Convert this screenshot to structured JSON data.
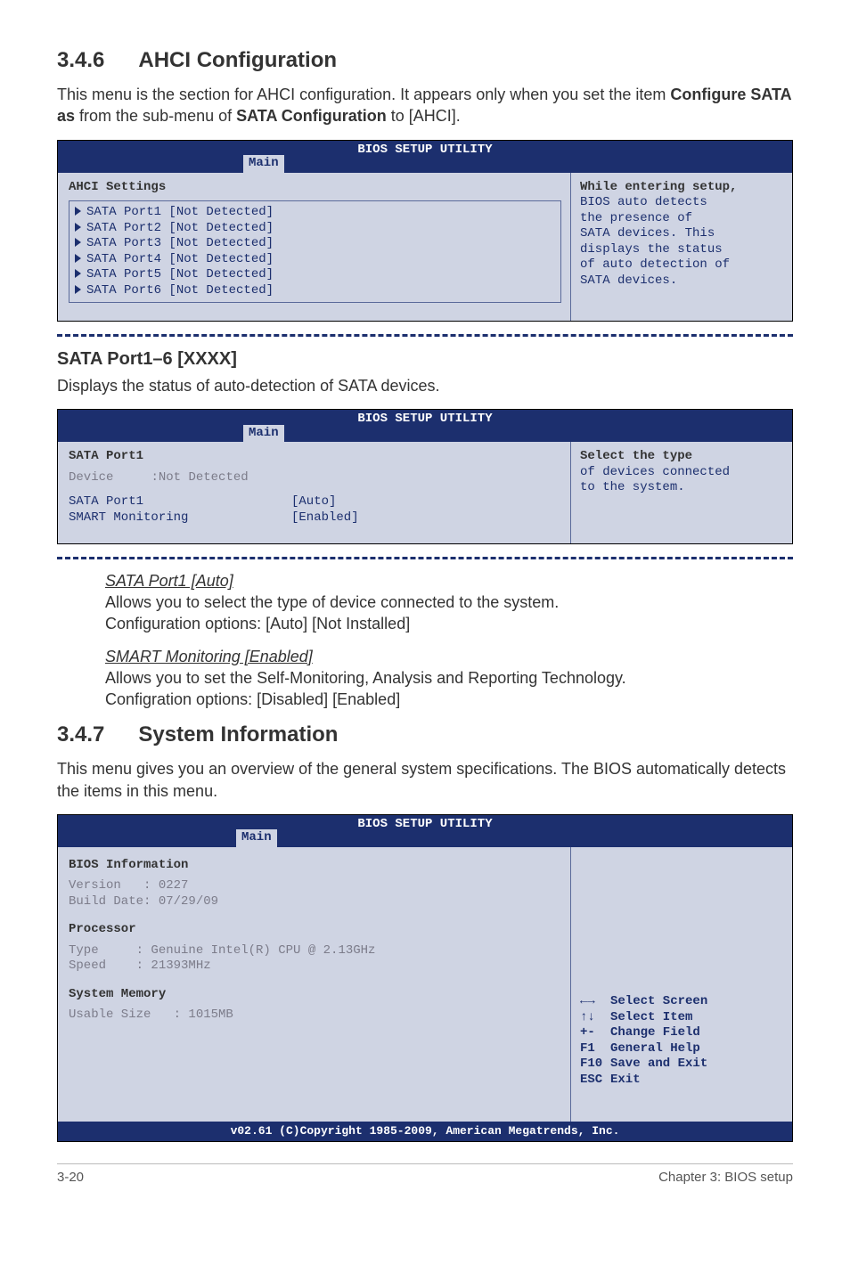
{
  "sec346": {
    "num": "3.4.6",
    "title": "AHCI Configuration",
    "intro_part1": "This menu is the section for AHCI configuration. It appears only when you set the item ",
    "intro_bold1": "Configure SATA as",
    "intro_part2": " from the sub-menu of ",
    "intro_bold2": "SATA Configuration",
    "intro_part3": " to [AHCI]."
  },
  "bios1": {
    "title": "BIOS SETUP UTILITY",
    "tab": "Main",
    "heading": "AHCI Settings",
    "items": [
      "SATA Port1 [Not Detected]",
      "SATA Port2 [Not Detected]",
      "SATA Port3 [Not Detected]",
      "SATA Port4 [Not Detected]",
      "SATA Port5 [Not Detected]",
      "SATA Port6 [Not Detected]"
    ],
    "help_first": "While entering setup,",
    "help_rest": "BIOS auto detects\nthe presence of\nSATA devices. This\ndisplays the status\nof auto detection of\nSATA devices."
  },
  "sataport": {
    "heading": "SATA Port1–6 [XXXX]",
    "desc": "Displays the status of auto-detection of SATA devices."
  },
  "bios2": {
    "title": "BIOS SETUP UTILITY",
    "tab": "Main",
    "heading": "SATA Port1",
    "dev_label": "Device",
    "dev_value": ":Not Detected",
    "row1_l": "SATA Port1",
    "row1_r": "[Auto]",
    "row2_l": "SMART Monitoring",
    "row2_r": "[Enabled]",
    "help_first": "Select the type",
    "help_rest": "of devices connected\nto the system."
  },
  "opts": {
    "o1_head": "SATA Port1 [Auto]",
    "o1_l1": "Allows you to select the type of device connected to the system.",
    "o1_l2": "Configuration options: [Auto] [Not Installed]",
    "o2_head": "SMART Monitoring [Enabled]",
    "o2_l1": "Allows you to set the Self-Monitoring, Analysis and Reporting Technology.",
    "o2_l2": "Configration options: [Disabled] [Enabled]"
  },
  "sec347": {
    "num": "3.4.7",
    "title": "System Information",
    "intro": "This menu gives you an overview of the general system specifications. The BIOS automatically detects the items in this menu."
  },
  "bios3": {
    "title": "BIOS SETUP UTILITY",
    "tab": "Main",
    "h1": "BIOS Information",
    "ver": "Version   : 0227",
    "bd": "Build Date: 07/29/09",
    "h2": "Processor",
    "ptype": "Type     : Genuine Intel(R) CPU @ 2.13GHz",
    "pspeed": "Speed    : 21393MHz",
    "h3": "System Memory",
    "mem": "Usable Size   : 1015MB",
    "nav": {
      "k1": "←→",
      "v1": "Select Screen",
      "k2": "↑↓",
      "v2": "Select Item",
      "k3": "+-",
      "v3": "Change Field",
      "k4": "F1",
      "v4": "General Help",
      "k5": "F10",
      "v5": "Save and Exit",
      "k6": "ESC",
      "v6": "Exit"
    },
    "footer": "v02.61 (C)Copyright 1985-2009, American Megatrends, Inc."
  },
  "footer": {
    "left": "3-20",
    "right": "Chapter 3: BIOS setup"
  }
}
